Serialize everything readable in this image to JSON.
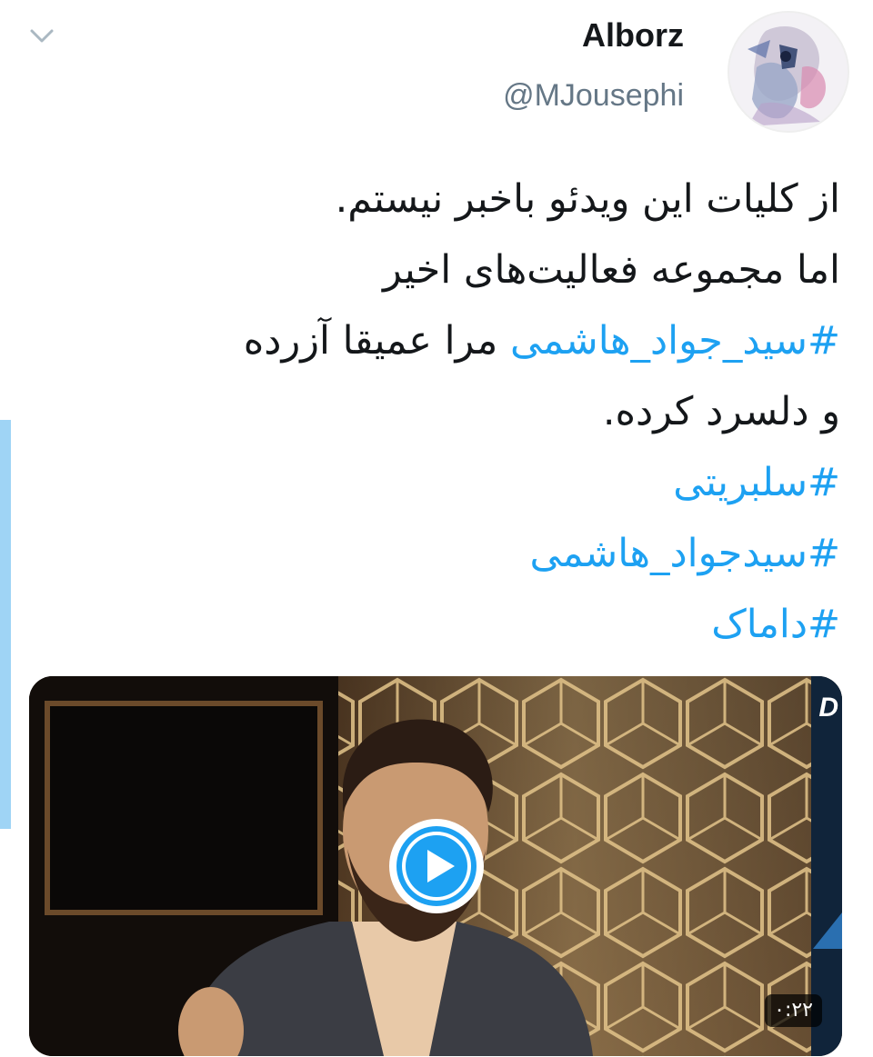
{
  "author": {
    "display_name": "Alborz",
    "handle": "@MJousephi"
  },
  "tweet": {
    "lines": [
      {
        "text": "از کلیات این ویدئو باخبر نیستم."
      },
      {
        "text": "اما مجموعه فعالیت‌های اخیر"
      },
      {
        "hashtag": "#سید_جواد_هاشمی",
        "rest": " مرا عمیقا آزرده"
      },
      {
        "text": "و دلسرد کرده."
      },
      {
        "hashtag": "#سلبریتی"
      },
      {
        "hashtag": "#سیدجواد_هاشمی"
      },
      {
        "hashtag": "#داماک"
      }
    ]
  },
  "video": {
    "duration": "۰:۲۲",
    "channel_logo": "D"
  },
  "icons": {
    "menu": "chevron-down-icon",
    "play": "play-icon"
  },
  "colors": {
    "hashtag": "#1da1f2",
    "text": "#14171a",
    "handle": "#657786",
    "accent_bar": "#9fd4f5"
  }
}
